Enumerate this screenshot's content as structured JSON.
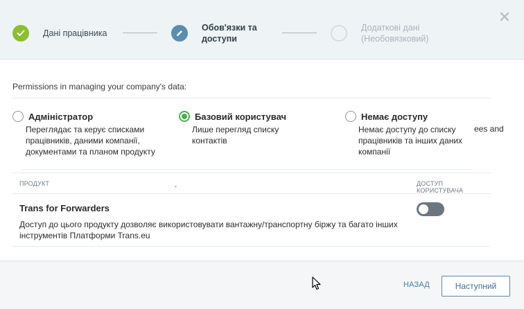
{
  "wizard": {
    "steps": [
      {
        "label": "Дані працівника",
        "state": "done",
        "icon": "check-icon"
      },
      {
        "label": "Обов'язки та доступи",
        "state": "active",
        "icon": "pencil-icon"
      },
      {
        "label": "Додаткові дані (Необовязковий)",
        "state": "pending",
        "icon": "empty-circle-icon"
      }
    ],
    "close_icon": "close-icon"
  },
  "permissions": {
    "title": "Permissions in managing your company's data:",
    "options": [
      {
        "name": "Адміністратор",
        "description": "Переглядає та керує списками працівників, даними компанії, документами та планом продукту",
        "selected": false
      },
      {
        "name": "Базовий користувач",
        "description": "Лише перегляд списку контактів",
        "selected": true
      },
      {
        "name": "Немає доступу",
        "description": "Немає доступу до списку працівників та інших даних компанії",
        "selected": false
      }
    ],
    "overflow_text": "ees and"
  },
  "products": {
    "header_product": "ПРОДУКТ",
    "header_access": "ДОСТУП КОРИСТУВАЧА",
    "marker": ".",
    "rows": [
      {
        "name": "Trans for Forwarders",
        "description": "Доступ до цього продукту дозволяє використовувати вантажну/транспортну біржу та багато інших інструментів Платформи Trans.eu",
        "access_enabled": false
      }
    ]
  },
  "footer": {
    "back_label": "НАЗАД",
    "next_label": "Наступний"
  },
  "colors": {
    "step_done": "#8cbf2f",
    "step_active": "#5b8dac",
    "radio_selected": "#4caf50",
    "link": "#3f7fb0",
    "toggle_off": "#6b7680"
  }
}
